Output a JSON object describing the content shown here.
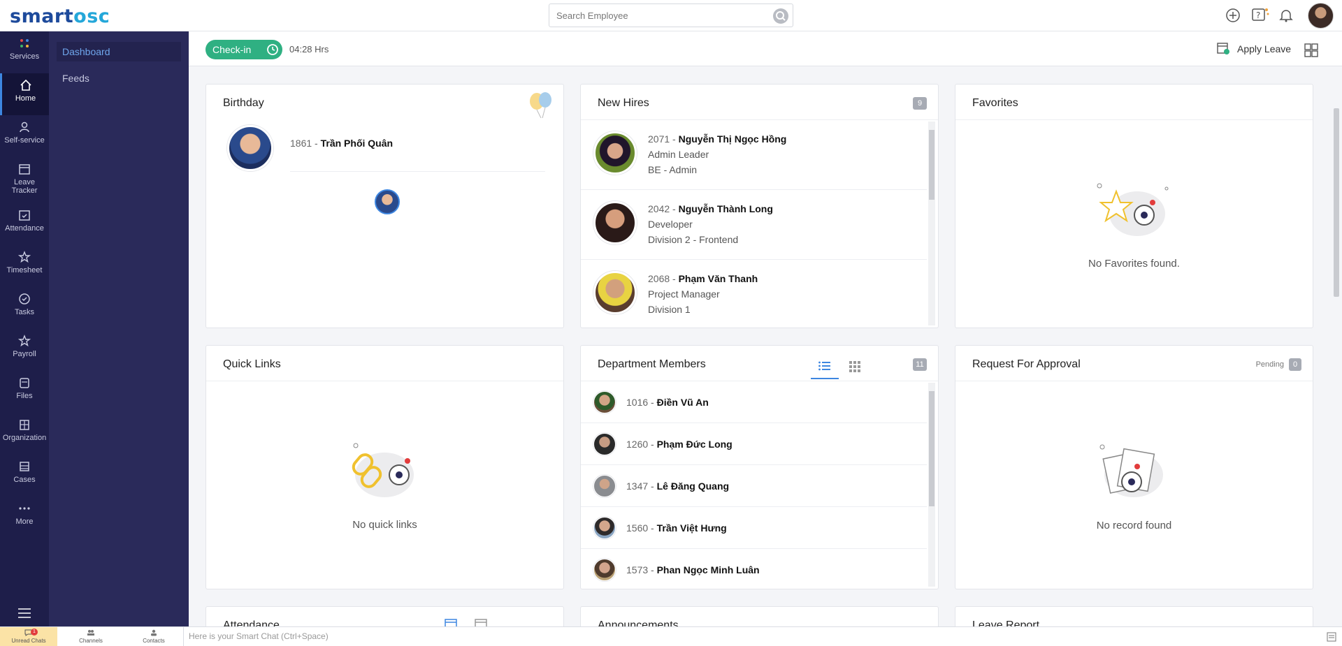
{
  "app": {
    "logo_part1": "smart",
    "logo_part2": "osc",
    "search_placeholder": "Search Employee"
  },
  "leftnav": [
    {
      "label": "Services",
      "icon": "services-dots-icon"
    },
    {
      "label": "Home",
      "icon": "home-icon",
      "active": true
    },
    {
      "label": "Self-service",
      "icon": "person-icon"
    },
    {
      "label": "Leave Tracker",
      "icon": "calendar-icon"
    },
    {
      "label": "Attendance",
      "icon": "calendar-check-icon"
    },
    {
      "label": "Timesheet",
      "icon": "star-icon"
    },
    {
      "label": "Tasks",
      "icon": "check-circle-icon"
    },
    {
      "label": "Payroll",
      "icon": "star-icon"
    },
    {
      "label": "Files",
      "icon": "files-icon"
    },
    {
      "label": "Organization",
      "icon": "building-icon"
    },
    {
      "label": "Cases",
      "icon": "cases-icon"
    },
    {
      "label": "More",
      "icon": "more-dots-icon"
    }
  ],
  "subnav": {
    "dashboard": "Dashboard",
    "feeds": "Feeds"
  },
  "subheader": {
    "checkin_label": "Check-in",
    "checkin_time": "04:28 Hrs",
    "apply_leave": "Apply Leave"
  },
  "birthday": {
    "title": "Birthday",
    "id": "1861 - ",
    "name": "Trần Phối Quân"
  },
  "new_hires": {
    "title": "New Hires",
    "count": "9",
    "items": [
      {
        "id": "2071 - ",
        "name": "Nguyễn Thị Ngọc Hồng",
        "role": "Admin Leader",
        "dept": "BE - Admin"
      },
      {
        "id": "2042 - ",
        "name": "Nguyễn Thành Long",
        "role": "Developer",
        "dept": "Division 2 - Frontend"
      },
      {
        "id": "2068 - ",
        "name": "Phạm Văn Thanh",
        "role": "Project Manager",
        "dept": "Division 1"
      }
    ]
  },
  "favorites": {
    "title": "Favorites",
    "empty": "No Favorites found."
  },
  "quick_links": {
    "title": "Quick Links",
    "empty": "No quick links"
  },
  "department_members": {
    "title": "Department Members",
    "count": "11",
    "items": [
      {
        "id": "1016 - ",
        "name": "Điền Vũ An"
      },
      {
        "id": "1260 - ",
        "name": "Phạm Đức Long"
      },
      {
        "id": "1347 - ",
        "name": "Lê Đăng Quang"
      },
      {
        "id": "1560 - ",
        "name": "Trần Việt Hưng"
      },
      {
        "id": "1573 - ",
        "name": "Phan Ngọc Minh Luân"
      }
    ]
  },
  "request_for_approval": {
    "title": "Request For Approval",
    "pending_label": "Pending",
    "pending_count": "0",
    "empty": "No record found"
  },
  "bottom_cards": {
    "attendance": "Attendance",
    "announcements": "Announcements",
    "leave_report": "Leave Report"
  },
  "chatbar": {
    "unread_chats": "Unread Chats",
    "unread_count": "1",
    "channels": "Channels",
    "contacts": "Contacts",
    "placeholder": "Here is your Smart Chat (Ctrl+Space)"
  },
  "colors": {
    "nav_bg": "#1e1e4a",
    "subnav_bg": "#2a2a5a",
    "accent": "#3d86e0",
    "checkin": "#2fb082"
  }
}
